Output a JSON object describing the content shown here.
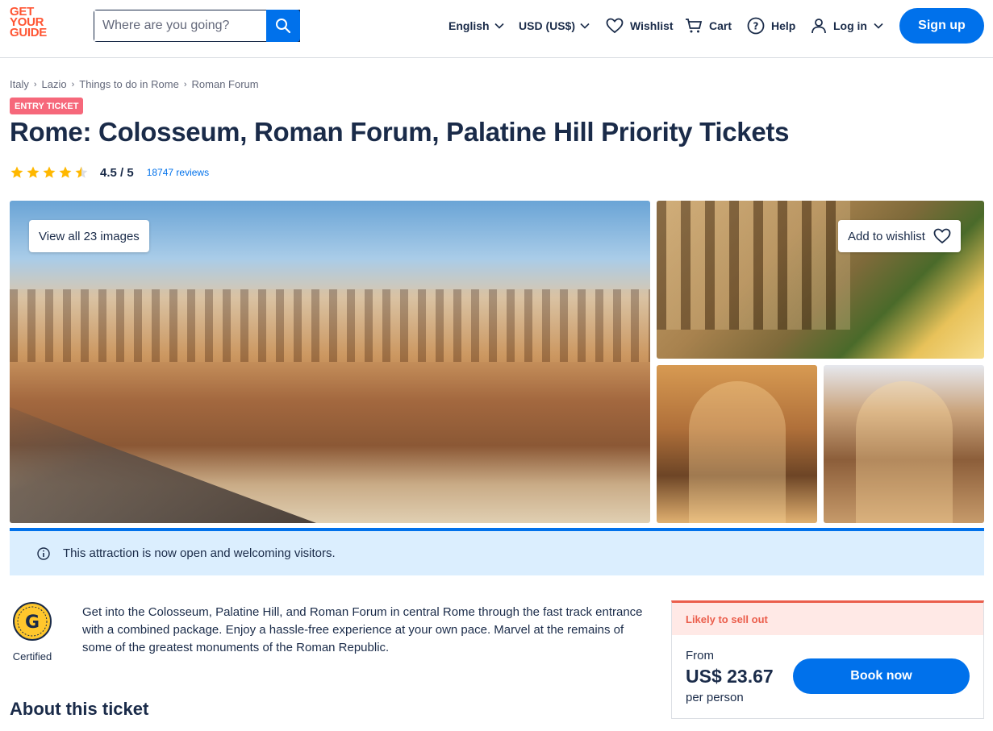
{
  "brand": {
    "logo_lines": [
      "GET",
      "YOUR",
      "GUIDE"
    ],
    "accent": "#ff5533",
    "primary": "#0071eb",
    "ink": "#1a2b49"
  },
  "header": {
    "search_placeholder": "Where are you going?",
    "language": "English",
    "currency": "USD (US$)",
    "wishlist": "Wishlist",
    "cart": "Cart",
    "help": "Help",
    "login": "Log in",
    "signup": "Sign up"
  },
  "breadcrumb": [
    "Italy",
    "Lazio",
    "Things to do in Rome",
    "Roman Forum"
  ],
  "badge": "ENTRY TICKET",
  "title": "Rome: Colosseum, Roman Forum, Palatine Hill Priority Tickets",
  "rating": {
    "stars": 4.5,
    "label": "4.5 / 5",
    "reviews": "18747 reviews"
  },
  "gallery": {
    "view_all": "View all 23 images",
    "add_wishlist": "Add to wishlist"
  },
  "notice": "This attraction is now open and welcoming visitors.",
  "certified": {
    "label": "Certified",
    "icon": "certified-badge-icon"
  },
  "description": "Get into the Colosseum, Palatine Hill, and Roman Forum in central Rome through the fast track entrance with a combined package. Enjoy a hassle-free experience at your own pace. Marvel at the remains of some of the greatest monuments of the Roman Republic.",
  "about_title": "About this ticket",
  "booking": {
    "urgency": "Likely to sell out",
    "from": "From",
    "price": "US$ 23.67",
    "per": "per person",
    "cta": "Book now",
    "urgency_color": "#eb5e4c"
  }
}
